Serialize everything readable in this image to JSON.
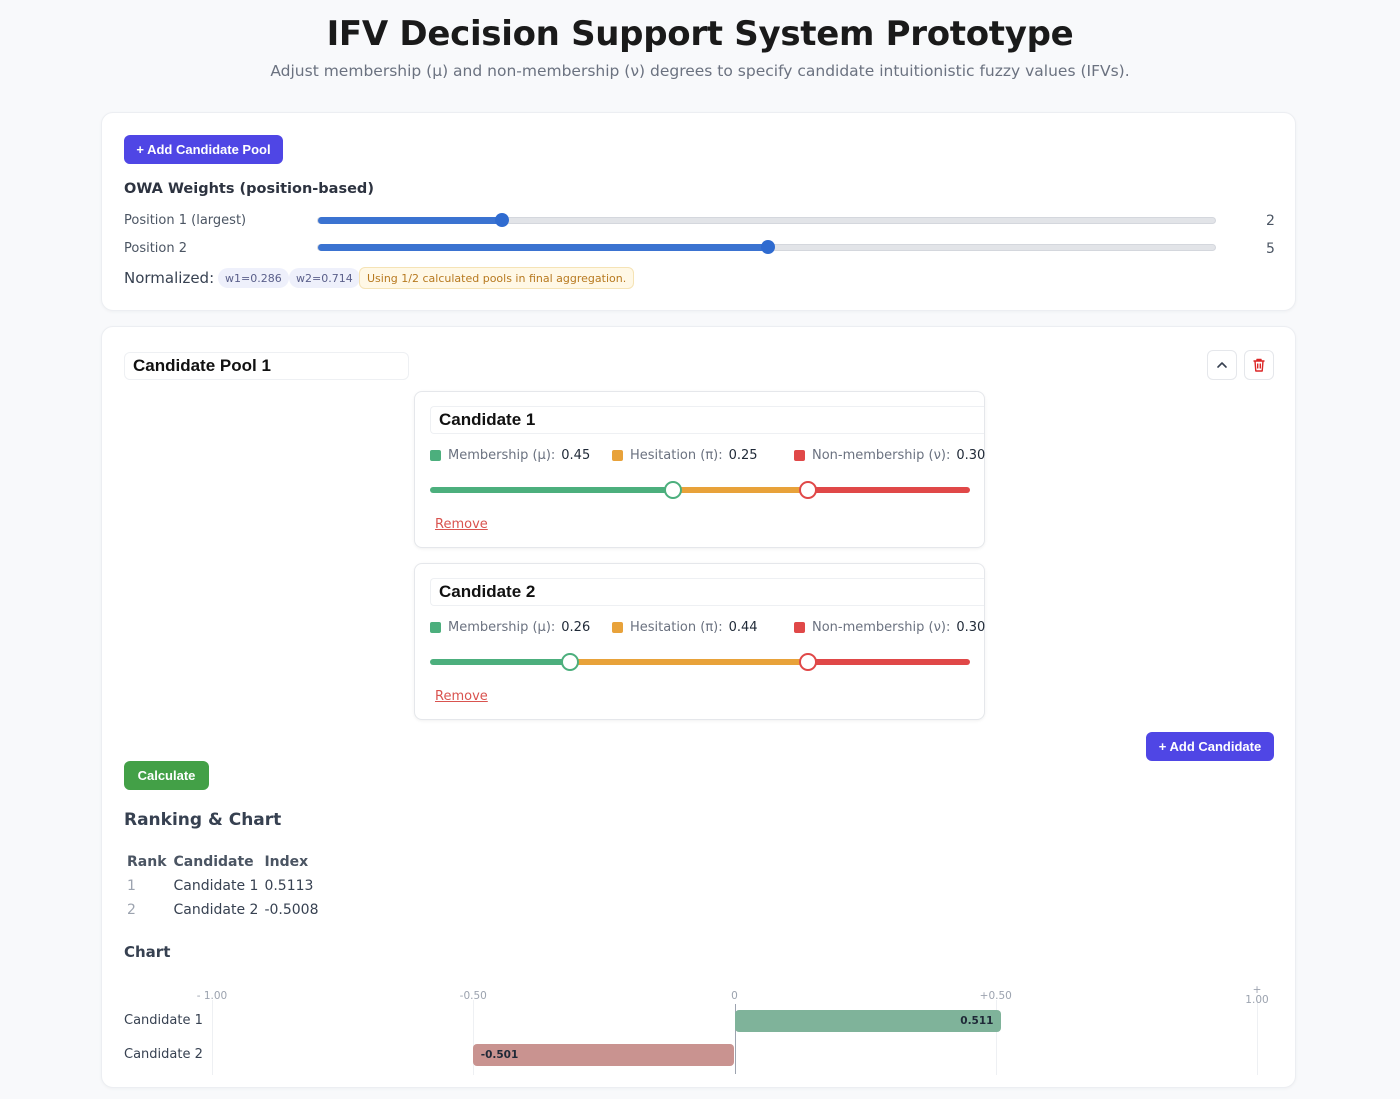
{
  "header": {
    "title": "IFV Decision Support System Prototype",
    "subtitle": "Adjust membership (μ) and non-membership (ν) degrees to specify candidate intuitionistic fuzzy values (IFVs)."
  },
  "settings": {
    "add_pool_label": "+ Add Candidate Pool",
    "owa_title": "OWA Weights (position-based)",
    "positions": [
      {
        "label": "Position 1 (largest)",
        "value": "2",
        "slider_fraction": 0.205
      },
      {
        "label": "Position 2",
        "value": "5",
        "slider_fraction": 0.5
      }
    ],
    "normalized_label": "Normalized:",
    "weights": [
      "w1=0.286",
      "w2=0.714"
    ],
    "notice": "Using 1/2 calculated pools in final aggregation."
  },
  "pool": {
    "title": "Candidate Pool 1",
    "collapse_icon": "chevron-up-icon",
    "delete_icon": "trash-icon",
    "candidates": [
      {
        "name": "Candidate 1",
        "mu_label": "Membership (μ):",
        "mu": "0.45",
        "pi_label": "Hesitation (π):",
        "pi": "0.25",
        "nu_label": "Non-membership (ν):",
        "nu": "0.30",
        "mu_value": 0.45,
        "pi_value": 0.25,
        "nu_value": 0.3,
        "remove_label": "Remove"
      },
      {
        "name": "Candidate 2",
        "mu_label": "Membership (μ):",
        "mu": "0.26",
        "pi_label": "Hesitation (π):",
        "pi": "0.44",
        "nu_label": "Non-membership (ν):",
        "nu": "0.30",
        "mu_value": 0.26,
        "pi_value": 0.44,
        "nu_value": 0.3,
        "remove_label": "Remove"
      }
    ],
    "add_candidate_label": "+ Add Candidate",
    "calculate_label": "Calculate",
    "ranking_title": "Ranking & Chart",
    "table": {
      "headers": [
        "Rank",
        "Candidate",
        "Index"
      ],
      "rows": [
        [
          "1",
          "Candidate 1",
          "0.5113"
        ],
        [
          "2",
          "Candidate 2",
          "-0.5008"
        ]
      ]
    },
    "chart_heading": "Chart"
  },
  "colors": {
    "membership": "#4caf7d",
    "hesitation": "#e8a23a",
    "non_membership": "#e04848",
    "positive_bar": "#7fb39a",
    "negative_bar": "#c99390",
    "primary": "#4f46e5",
    "calculate": "#43a047"
  },
  "chart_data": {
    "type": "bar",
    "orientation": "horizontal",
    "categories": [
      "Candidate 1",
      "Candidate 2"
    ],
    "values": [
      0.511,
      -0.501
    ],
    "value_labels": [
      "0.511",
      "-0.501"
    ],
    "tick_labels": [
      "- 1.00",
      "-0.50",
      "0",
      "+0.50",
      "+\n1.00"
    ],
    "xlim": [
      -1,
      1
    ],
    "grid": true
  }
}
